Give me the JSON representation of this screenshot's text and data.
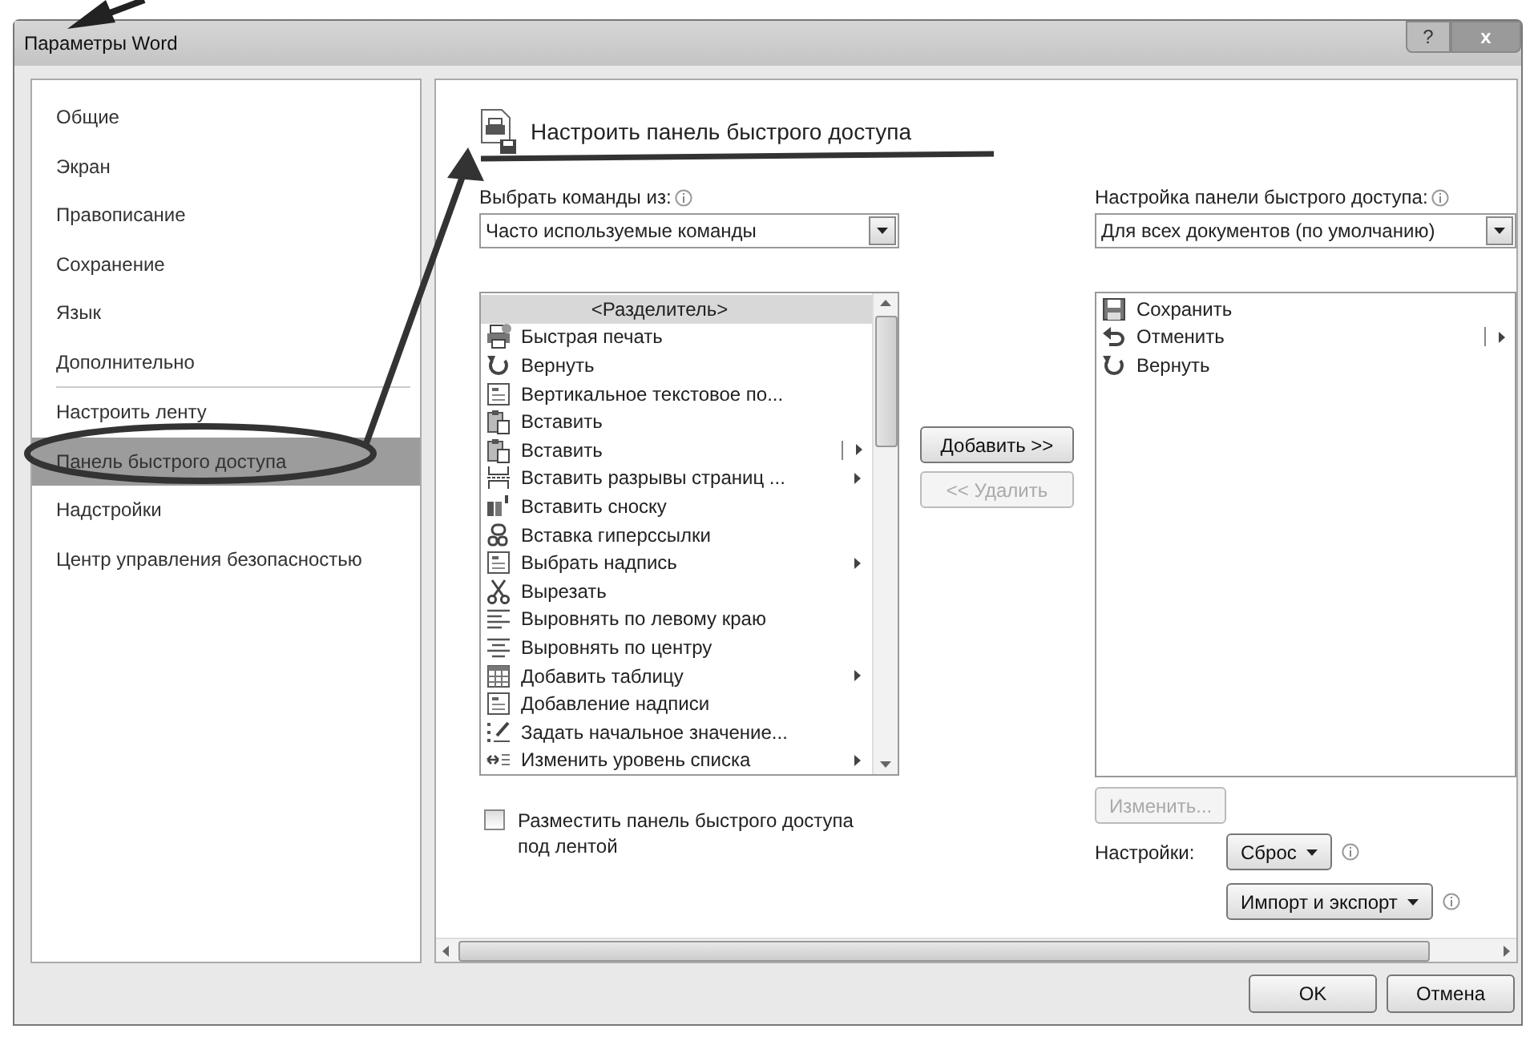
{
  "window": {
    "title": "Параметры Word",
    "help_button": "?",
    "close_button": "x"
  },
  "sidebar": {
    "items": [
      {
        "label": "Общие",
        "selected": false,
        "separator_above": false
      },
      {
        "label": "Экран",
        "selected": false,
        "separator_above": false
      },
      {
        "label": "Правописание",
        "selected": false,
        "separator_above": false
      },
      {
        "label": "Сохранение",
        "selected": false,
        "separator_above": false
      },
      {
        "label": "Язык",
        "selected": false,
        "separator_above": false
      },
      {
        "label": "Дополнительно",
        "selected": false,
        "separator_above": false
      },
      {
        "label": "Настроить ленту",
        "selected": false,
        "separator_above": true
      },
      {
        "label": "Панель быстрого доступа",
        "selected": true,
        "separator_above": false
      },
      {
        "label": "Надстройки",
        "selected": false,
        "separator_above": false
      },
      {
        "label": "Центр управления безопасностью",
        "selected": false,
        "separator_above": false
      }
    ]
  },
  "page": {
    "heading": "Настроить панель быстрого доступа",
    "commands_label": "Выбрать команды из:",
    "commands_source": "Часто используемые команды",
    "commands": [
      {
        "label": "<Разделитель>",
        "kind": "separator",
        "selected": true,
        "submenu": false
      },
      {
        "label": "Быстрая печать",
        "kind": "command",
        "selected": false,
        "submenu": false
      },
      {
        "label": "Вернуть",
        "kind": "command",
        "selected": false,
        "submenu": false
      },
      {
        "label": "Вертикальное текстовое по...",
        "kind": "command",
        "selected": false,
        "submenu": false
      },
      {
        "label": "Вставить",
        "kind": "command",
        "selected": false,
        "submenu": false
      },
      {
        "label": "Вставить",
        "kind": "split",
        "selected": false,
        "submenu": true
      },
      {
        "label": "Вставить разрывы страниц ...",
        "kind": "command",
        "selected": false,
        "submenu": true
      },
      {
        "label": "Вставить сноску",
        "kind": "command",
        "selected": false,
        "submenu": false
      },
      {
        "label": "Вставка гиперссылки",
        "kind": "command",
        "selected": false,
        "submenu": false
      },
      {
        "label": "Выбрать надпись",
        "kind": "command",
        "selected": false,
        "submenu": true
      },
      {
        "label": "Вырезать",
        "kind": "command",
        "selected": false,
        "submenu": false
      },
      {
        "label": "Выровнять по левому краю",
        "kind": "command",
        "selected": false,
        "submenu": false
      },
      {
        "label": "Выровнять по центру",
        "kind": "command",
        "selected": false,
        "submenu": false
      },
      {
        "label": "Добавить таблицу",
        "kind": "command",
        "selected": false,
        "submenu": true
      },
      {
        "label": "Добавление надписи",
        "kind": "command",
        "selected": false,
        "submenu": false
      },
      {
        "label": "Задать начальное значение...",
        "kind": "command",
        "selected": false,
        "submenu": false
      },
      {
        "label": "Изменить уровень списка",
        "kind": "command",
        "selected": false,
        "submenu": true
      }
    ],
    "place_below_ribbon": {
      "label": "Разместить панель быстрого доступа под лентой",
      "checked": false
    },
    "add_button": {
      "label": "Добавить >>",
      "disabled": false
    },
    "remove_button": {
      "label": "<< Удалить",
      "disabled": true
    },
    "toolbar_label": "Настройка панели быстрого доступа:",
    "toolbar_scope": "Для всех документов (по умолчанию)",
    "toolbar_commands": [
      {
        "label": "Сохранить",
        "kind": "command",
        "selected": false,
        "submenu": false
      },
      {
        "label": "Отменить",
        "kind": "split",
        "selected": false,
        "submenu": true
      },
      {
        "label": "Вернуть",
        "kind": "command",
        "selected": false,
        "submenu": false
      }
    ],
    "modify_button": {
      "label": "Изменить...",
      "disabled": true
    },
    "customizations_label": "Настройки:",
    "reset_button": "Сброс",
    "import_export_button": "Импорт и экспорт"
  },
  "buttons": [
    {
      "label": "OK"
    },
    {
      "label": "Отмена"
    }
  ]
}
